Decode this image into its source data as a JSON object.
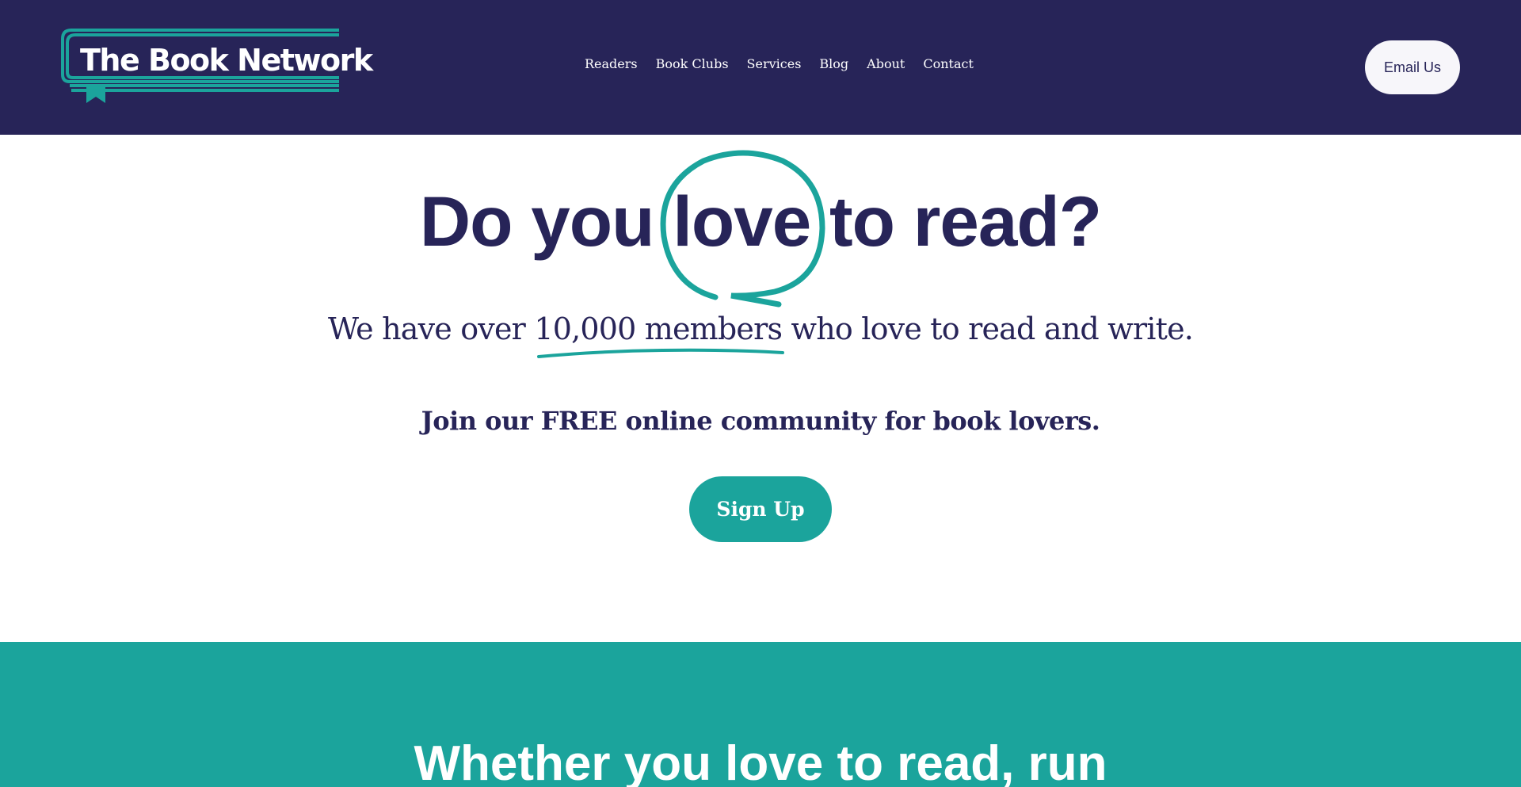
{
  "brand": {
    "name": "The Book Network",
    "accent": "#1ba49c",
    "navy": "#272458"
  },
  "nav": {
    "items": [
      {
        "label": "Readers"
      },
      {
        "label": "Book Clubs"
      },
      {
        "label": "Services"
      },
      {
        "label": "Blog"
      },
      {
        "label": "About"
      },
      {
        "label": "Contact"
      }
    ],
    "cta_label": "Email Us"
  },
  "hero": {
    "title_before": "Do you ",
    "title_highlight": "love",
    "title_after": " to read?",
    "sub_before": "We have over ",
    "sub_highlight": "10,000 members",
    "sub_after": " who love to read and write.",
    "join_text": "Join our FREE online community for book lovers.",
    "signup_label": "Sign Up"
  },
  "band": {
    "title": "Whether you love to read, run"
  }
}
